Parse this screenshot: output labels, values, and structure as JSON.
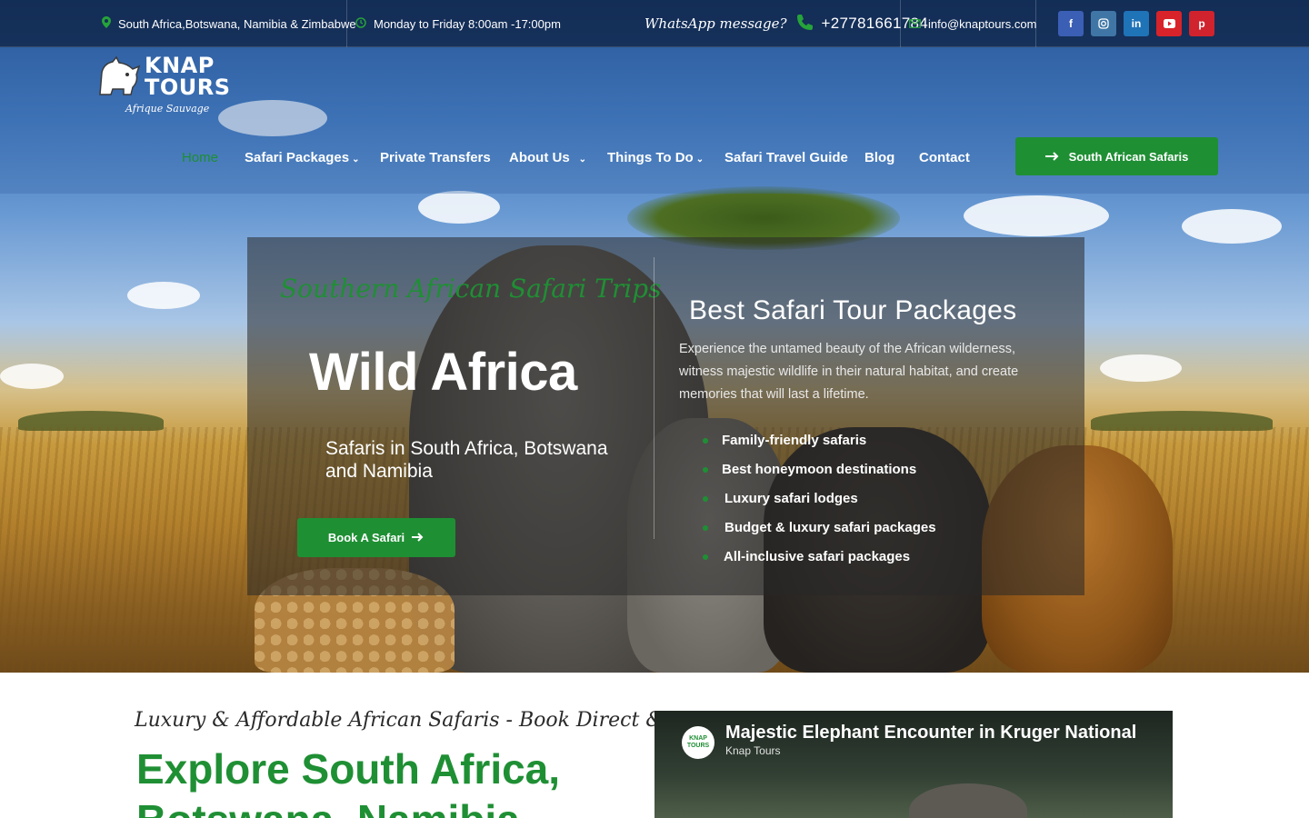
{
  "topbar": {
    "location": "South Africa,Botswana, Namibia & Zimbabwe",
    "hours": "Monday to Friday 8:00am -17:00pm",
    "whatsapp_label": "WhatsApp message?",
    "phone": "+27781661784",
    "email": "info@knaptours.com",
    "social": [
      "f",
      "ig",
      "in",
      "yt",
      "p"
    ]
  },
  "logo": {
    "line1": "KNAP",
    "line2": "TOURS",
    "tagline": "Afrique Sauvage"
  },
  "nav": {
    "items": [
      {
        "label": "Home",
        "active": true
      },
      {
        "label": "Safari Packages",
        "dropdown": true
      },
      {
        "label": "Private Transfers"
      },
      {
        "label": "About Us",
        "dropdown": true
      },
      {
        "label": "Things To Do",
        "dropdown": true
      },
      {
        "label": "Safari Travel Guide"
      },
      {
        "label": "Blog"
      },
      {
        "label": "Contact"
      }
    ],
    "cta": "South African Safaris"
  },
  "hero": {
    "script_title": "Southern African Safari Trips",
    "headline": "Wild Africa",
    "lead": "Safaris in South Africa, Botswana and Namibia",
    "book_button": "Book A Safari",
    "right_title": "Best Safari Tour Packages",
    "right_text": "Experience the untamed beauty of the African wilderness, witness majestic wildlife in their natural habitat, and create memories that will last a lifetime.",
    "features": [
      "Family-friendly safaris",
      "Best honeymoon destinations",
      "Luxury safari lodges",
      "Budget & luxury safari packages",
      "All-inclusive safari packages"
    ]
  },
  "intro": {
    "script": "Luxury & Affordable African Safaris - Book Direct & Save",
    "title": "Explore South Africa, Botswana, Namibia"
  },
  "video": {
    "title": "Majestic Elephant Encounter in Kruger National Park",
    "channel": "Knap Tours",
    "avatar_text": "KNAP TOURS"
  },
  "colors": {
    "brand_green": "#1f8f34",
    "topbar_bg": "#0e203e"
  }
}
